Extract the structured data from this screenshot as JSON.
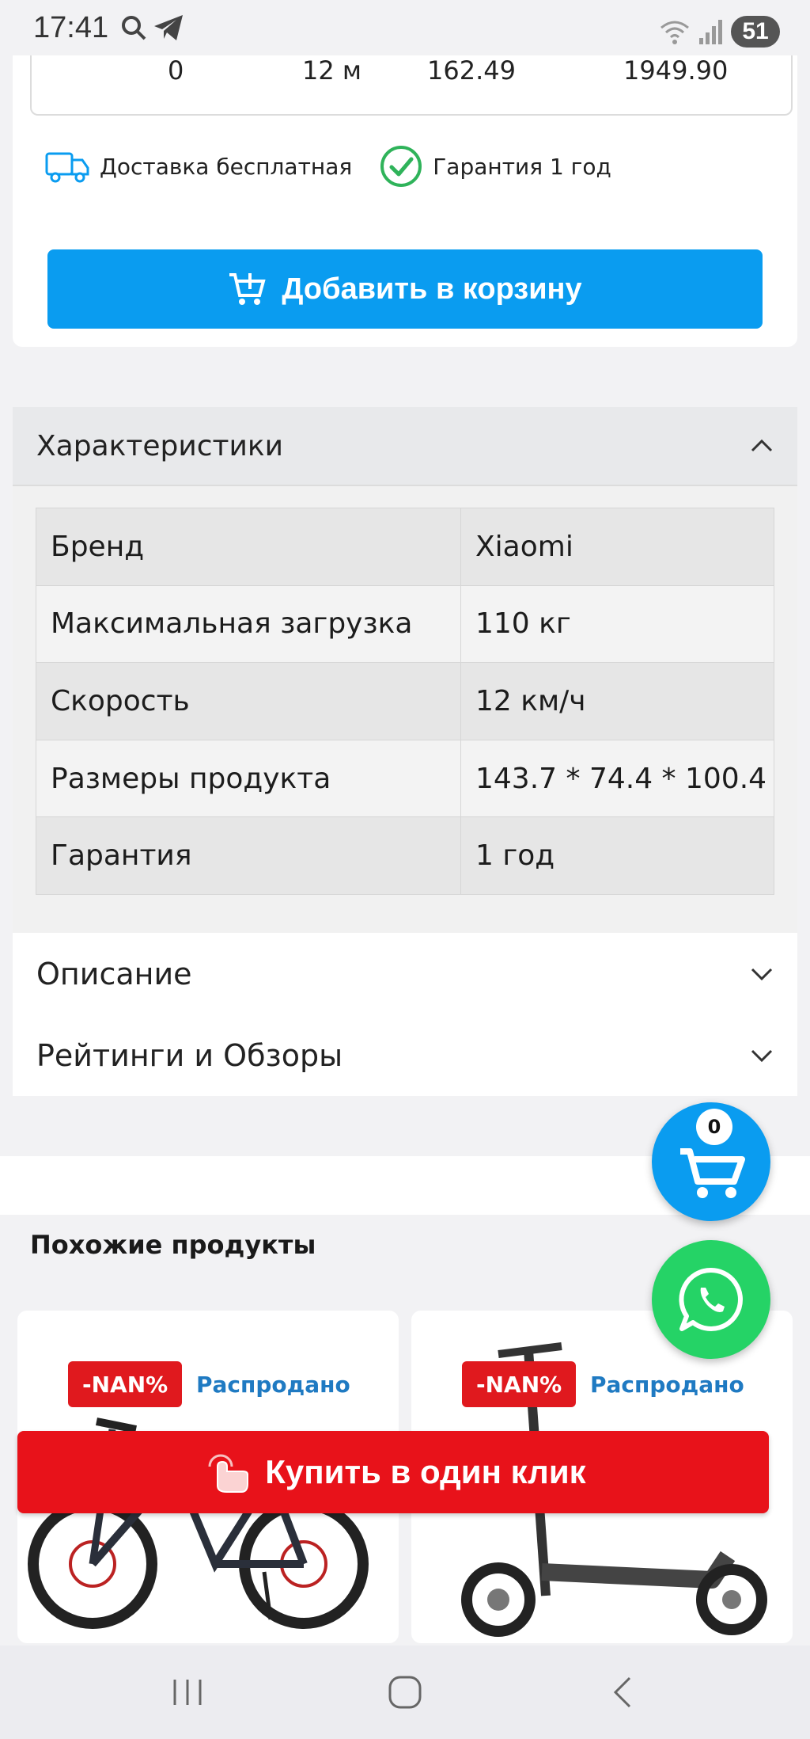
{
  "status_bar": {
    "time": "17:41",
    "battery": "51"
  },
  "installment_row": {
    "col1": "0",
    "col2": "12 м",
    "col3": "162.49",
    "col4": "1949.90"
  },
  "features": {
    "delivery": "Доставка бесплатная",
    "warranty": "Гарантия 1 год"
  },
  "add_to_cart_label": "Добавить в корзину",
  "characteristics": {
    "title": "Характеристики",
    "rows": [
      {
        "name": "Бренд",
        "value": "Xiaomi"
      },
      {
        "name": "Максимальная загрузка",
        "value": "110 кг"
      },
      {
        "name": "Скорость",
        "value": "12 км/ч"
      },
      {
        "name": "Размеры продукта",
        "value": "143.7 * 74.4 * 100.4"
      },
      {
        "name": "Гарантия",
        "value": "1 год"
      }
    ]
  },
  "accordions": {
    "description": "Описание",
    "ratings": "Рейтинги и Обзоры"
  },
  "similar": {
    "title": "Похожие продукты",
    "products": [
      {
        "discount": "-NAN%",
        "status": "Распродано",
        "icon": "bicycle-image"
      },
      {
        "discount": "-NAN%",
        "status": "Распродано",
        "icon": "scooter-image"
      }
    ]
  },
  "cart_count": "0",
  "buy_one_click_label": "Купить в один клик",
  "colors": {
    "accent_blue": "#0a9cf0",
    "red": "#e8121a",
    "whatsapp": "#25d366",
    "status_blue": "#1f7ac2"
  }
}
